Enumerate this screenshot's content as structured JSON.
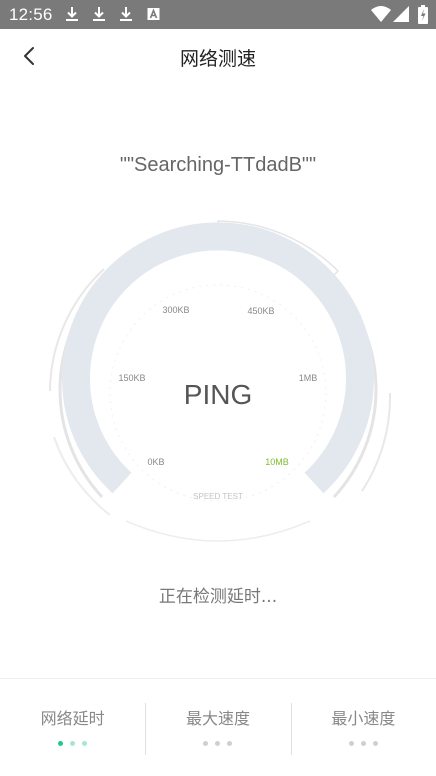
{
  "statusbar": {
    "time": "12:56",
    "icons": [
      "download-icon",
      "download-icon",
      "download-icon",
      "a-notification-icon",
      "wifi-icon",
      "signal-icon",
      "battery-icon"
    ]
  },
  "header": {
    "title": "网络测速",
    "back_icon": "chevron-left-icon"
  },
  "network": {
    "ssid": "\"\"Searching-TTdadB\"\""
  },
  "gauge": {
    "center_text": "PING",
    "caption": "SPEED TEST",
    "scale_labels": [
      "0KB",
      "150KB",
      "300KB",
      "450KB",
      "1MB",
      "10MB"
    ],
    "highlight_label": "10MB",
    "colors": {
      "track": "#e3e8ef",
      "ring": "#e6e6e6",
      "label": "#888888",
      "highlight": "#7bbf2a"
    }
  },
  "status": {
    "text": "正在检测延时..."
  },
  "tabs": [
    {
      "label": "网络延时",
      "active": true
    },
    {
      "label": "最大速度",
      "active": false
    },
    {
      "label": "最小速度",
      "active": false
    }
  ],
  "colors": {
    "accent": "#1fc98a",
    "statusbar": "#7a7a7a"
  }
}
